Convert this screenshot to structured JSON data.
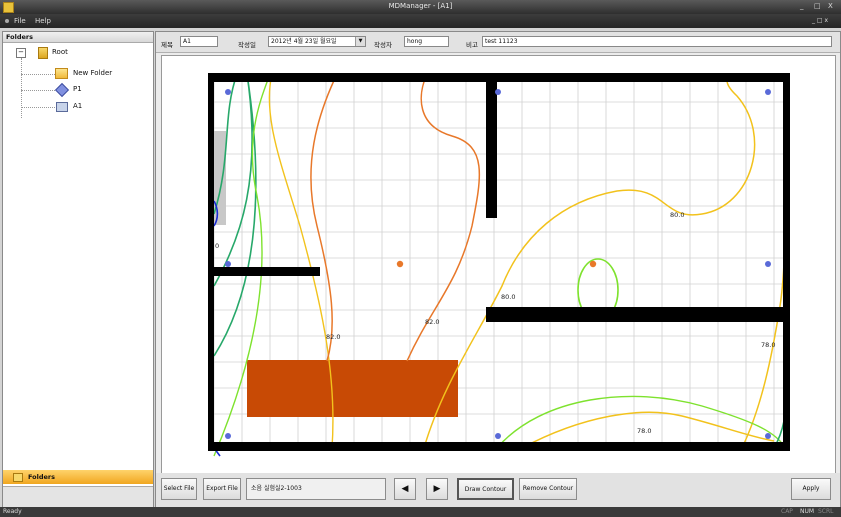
{
  "window": {
    "title": "MDManager - [A1]",
    "minimize": "_",
    "maximize": "□",
    "close": "X"
  },
  "menu": {
    "items": [
      "File",
      "Help"
    ],
    "mdi_controls": "_ □ x"
  },
  "left_panel": {
    "header": "Folders",
    "tree": [
      {
        "label": "Root",
        "expander": "−"
      },
      {
        "label": "New Folder"
      },
      {
        "label": "P1"
      },
      {
        "label": "A1"
      }
    ],
    "footer_tab": "Folders"
  },
  "form": {
    "title_label": "제목",
    "title_value": "A1",
    "date_label": "작성일",
    "date_value": "2012년  4월 23일 월요일",
    "author_label": "작성자",
    "author_value": "hong",
    "note_label": "비고",
    "note_value": "test 11123"
  },
  "contours": {
    "labels": [
      "82.0",
      "82.0",
      "80.0",
      "80.0",
      "78.0",
      "78.0"
    ],
    "edge_label": "0",
    "colors": {
      "orange": "#e8782a",
      "yellow": "#f2c21c",
      "light_green": "#7ee22e",
      "green": "#27a86a",
      "blue": "#1a2bd4",
      "room": "#c84a05",
      "wall": "#000000"
    }
  },
  "bottom": {
    "select_file": "Select File",
    "export_file": "Export File",
    "file_name": "소음 실험실2-1003",
    "prev": "◀",
    "next": "▶",
    "draw_contour": "Draw Contour",
    "remove_contour": "Remove Contour",
    "apply": "Apply"
  },
  "status": {
    "text": "Ready",
    "indicators": [
      "CAP",
      "NUM",
      "SCRL"
    ]
  }
}
